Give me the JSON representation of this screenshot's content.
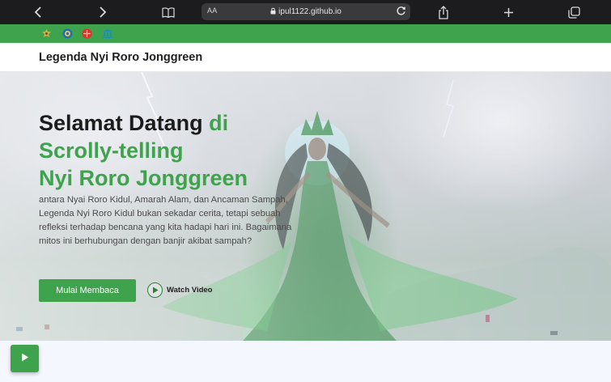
{
  "browser": {
    "address_prefix": "AA",
    "url": "ipul1122.github.io",
    "icons": [
      "chevron-left-icon",
      "chevron-right-icon",
      "book-icon",
      "lock-icon",
      "reload-icon",
      "share-icon",
      "plus-icon",
      "tabs-icon"
    ]
  },
  "strip": {
    "logos": [
      "emblem-logo",
      "circle-logo",
      "red-logo",
      "building-logo"
    ],
    "color": "#3fa34d"
  },
  "header": {
    "title": "Legenda Nyi Roro Jonggreen"
  },
  "hero": {
    "title_line1_dark": "Selamat Datang ",
    "title_line1_green": "di",
    "title_line2": "Scrolly-telling",
    "title_line3": "Nyi Roro Jonggreen",
    "description": "antara Nyai Roro Kidul, Amarah Alam, dan Ancaman Sampah, Legenda Nyi Roro Kidul bukan sekadar cerita, tetapi sebuah refleksi terhadap bencana yang kita hadapi hari ini. Bagaimana mitos ini berhubungan dengan banjir akibat sampah?",
    "primary_button": "Mulai Membaca",
    "watch_label": "Watch Video"
  },
  "colors": {
    "accent": "#3fa34d",
    "text_dark": "#1c1c1c"
  }
}
